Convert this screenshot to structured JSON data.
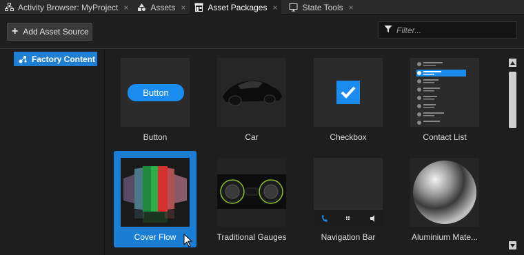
{
  "tabs": [
    {
      "label": "Activity Browser: MyProject",
      "icon": "hierarchy-icon",
      "active": false
    },
    {
      "label": "Assets",
      "icon": "assets-icon",
      "active": false
    },
    {
      "label": "Asset Packages",
      "icon": "store-icon",
      "active": true
    },
    {
      "label": "State Tools",
      "icon": "monitor-icon",
      "active": false
    }
  ],
  "tab_close_glyph": "×",
  "toolbar": {
    "add_asset_source_label": "Add Asset Source",
    "add_icon": "+",
    "filter_placeholder": "Filter...",
    "filter_value": ""
  },
  "tree": {
    "selected_item": "Factory Content",
    "icon": "factory-icon"
  },
  "packages": [
    {
      "label": "Button",
      "thumb_text": "Button",
      "selected": false
    },
    {
      "label": "Car",
      "selected": false
    },
    {
      "label": "Checkbox",
      "selected": false
    },
    {
      "label": "Contact List",
      "selected": false
    },
    {
      "label": "Cover Flow",
      "selected": true
    },
    {
      "label": "Traditional Gauges",
      "selected": false
    },
    {
      "label": "Navigation Bar",
      "selected": false
    },
    {
      "label": "Aluminium Mate...",
      "selected": false
    }
  ],
  "colors": {
    "accent": "#1a7fd4",
    "background": "#1e1e1e",
    "tab_bar": "#2a2a2a"
  }
}
